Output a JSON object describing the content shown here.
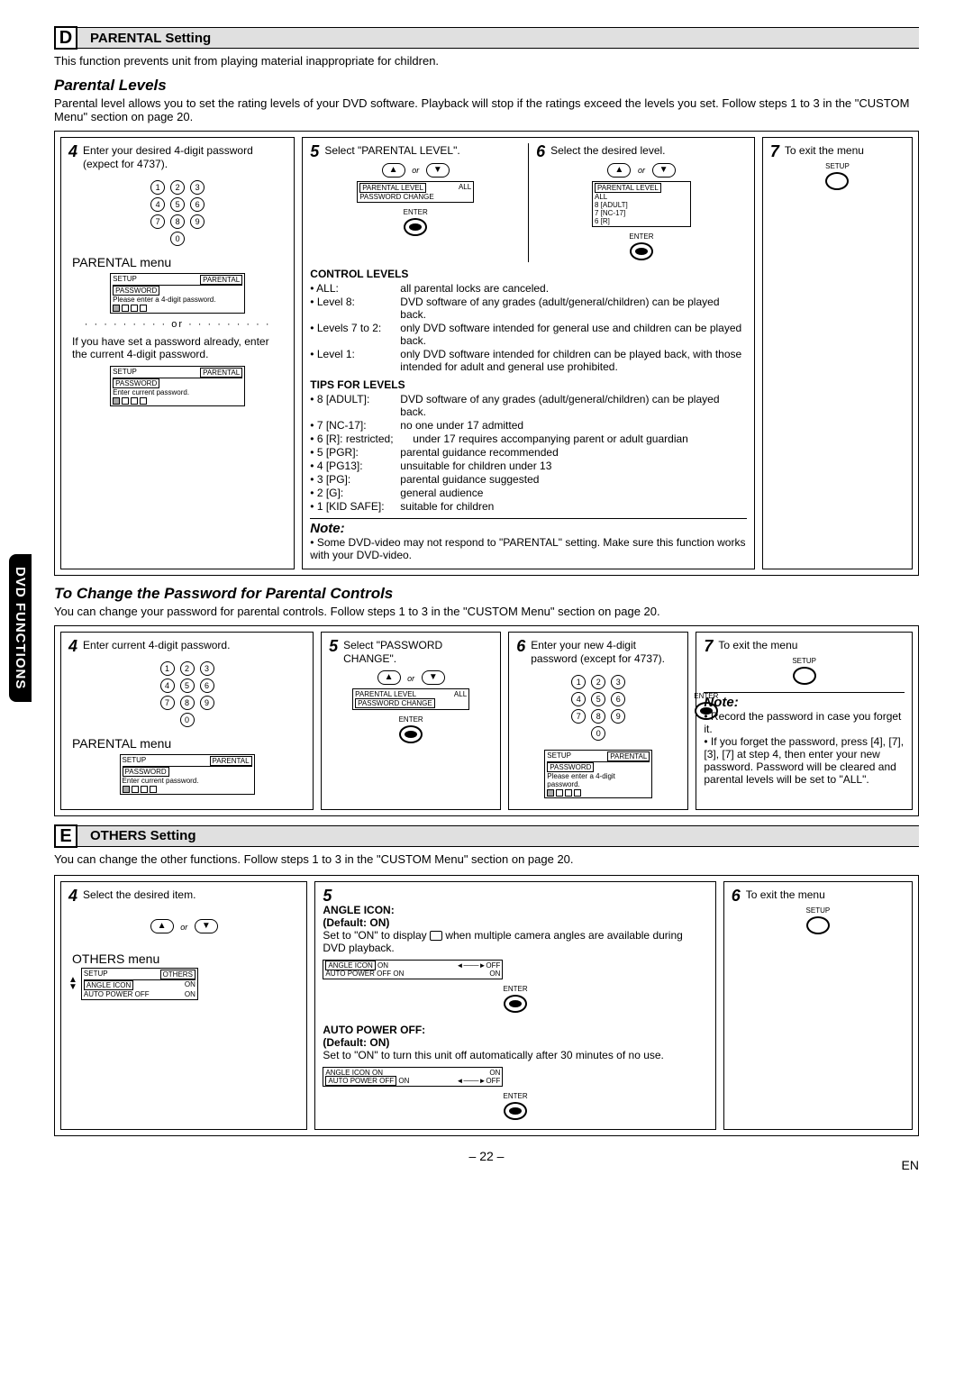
{
  "sideTab": "DVD FUNCTIONS",
  "sectionD": {
    "letter": "D",
    "title": "PARENTAL Setting",
    "intro": "This function prevents unit from playing material inappropriate for children.",
    "parentalLevels": {
      "heading": "Parental Levels",
      "body": "Parental level allows you to set the rating levels of your DVD software. Playback will stop if the ratings exceed the levels you set. Follow steps 1 to 3 in the \"CUSTOM Menu\" section on page 20."
    },
    "steps": {
      "s4": {
        "num": "4",
        "text": "Enter your desired 4-digit password (expect for 4737).",
        "menuLabel": "PARENTAL menu",
        "orDivider": "· · · · · · · · ·  or  · · · · · · · · ·",
        "instruct": "If you have set a password already, enter the current 4-digit password."
      },
      "s5": {
        "num": "5",
        "text": "Select \"PARENTAL LEVEL\"."
      },
      "s6": {
        "num": "6",
        "text": "Select the desired level."
      },
      "s7": {
        "num": "7",
        "text": "To exit the menu"
      }
    },
    "osd": {
      "setup": "SETUP",
      "parental": "PARENTAL",
      "password": "PASSWORD",
      "enter4": "Please enter a 4-digit password.",
      "enterCurrent": "Enter current password.",
      "parentalLevel": "PARENTAL LEVEL",
      "all": "ALL",
      "passwordChange": "PASSWORD CHANGE",
      "levels": [
        "ALL",
        "8 [ADULT]",
        "7 [NC-17]",
        "6 [R]"
      ]
    },
    "buttons": {
      "enter": "ENTER",
      "setup": "SETUP",
      "or": "or"
    },
    "controlLevels": {
      "heading": "CONTROL LEVELS",
      "rows": [
        {
          "l": "ALL:",
          "v": "all parental locks are canceled."
        },
        {
          "l": "Level 8:",
          "v": "DVD software of any grades (adult/general/children) can be played back."
        },
        {
          "l": "Levels 7 to 2:",
          "v": "only DVD software intended for general use and children can be played back."
        },
        {
          "l": "Level 1:",
          "v": "only DVD software intended for children can be played back, with those intended for adult and general use prohibited."
        }
      ]
    },
    "tips": {
      "heading": "TIPS FOR LEVELS",
      "rows": [
        {
          "l": "8 [ADULT]:",
          "v": "DVD software of any grades (adult/general/children) can be played back."
        },
        {
          "l": "7 [NC-17]:",
          "v": "no one under 17 admitted"
        },
        {
          "l": "6 [R]: restricted;",
          "v": "under 17 requires accompanying parent or adult guardian"
        },
        {
          "l": "5 [PGR]:",
          "v": "parental guidance recommended"
        },
        {
          "l": "4 [PG13]:",
          "v": "unsuitable for children under 13"
        },
        {
          "l": "3 [PG]:",
          "v": "parental guidance suggested"
        },
        {
          "l": "2 [G]:",
          "v": "general audience"
        },
        {
          "l": "1 [KID SAFE]:",
          "v": "suitable for children"
        }
      ]
    },
    "note": {
      "head": "Note:",
      "body": "Some DVD-video may not respond to \"PARENTAL\" setting. Make sure this function works with your DVD-video."
    },
    "changePw": {
      "heading": "To Change the Password for Parental Controls",
      "body": "You can change your password for parental controls.  Follow steps 1 to 3 in the \"CUSTOM Menu\" section on page 20.",
      "s4": {
        "num": "4",
        "text": "Enter current 4-digit password.",
        "menuLabel": "PARENTAL menu"
      },
      "s5": {
        "num": "5",
        "text": "Select \"PASSWORD CHANGE\"."
      },
      "s6": {
        "num": "6",
        "text": "Enter your new 4-digit password (except for 4737)."
      },
      "s7": {
        "num": "7",
        "text": "To exit the menu",
        "noteHead": "Note:",
        "noteBody": [
          "Record the password in case you forget it.",
          "If you forget the password, press [4], [7], [3], [7] at step 4, then enter your new password. Password will be cleared and parental levels will be set to \"ALL\"."
        ]
      }
    }
  },
  "sectionE": {
    "letter": "E",
    "title": "OTHERS Setting",
    "intro": "You can change the other functions. Follow steps 1 to 3 in the \"CUSTOM Menu\" section on page 20.",
    "s4": {
      "num": "4",
      "text": "Select the desired item.",
      "menuLabel": "OTHERS menu"
    },
    "s5": {
      "num": "5",
      "angle": {
        "head": "ANGLE ICON:",
        "def": "(Default: ON)",
        "body1": "Set to \"ON\" to display ",
        "body2": " when multiple camera angles are available during DVD playback."
      },
      "auto": {
        "head": "AUTO POWER OFF:",
        "def": "(Default: ON)",
        "body": "Set to \"ON\" to turn this unit off automatically after 30 minutes of no use."
      },
      "osdRows": {
        "angleIcon": "ANGLE ICON",
        "autoPower": "AUTO POWER OFF",
        "on": "ON",
        "off": "OFF",
        "setup": "SETUP",
        "others": "OTHERS"
      }
    },
    "s6": {
      "num": "6",
      "text": "To exit the menu"
    },
    "buttons": {
      "enter": "ENTER",
      "setup": "SETUP",
      "or": "or"
    }
  },
  "footer": {
    "page": "– 22 –",
    "lang": "EN"
  }
}
